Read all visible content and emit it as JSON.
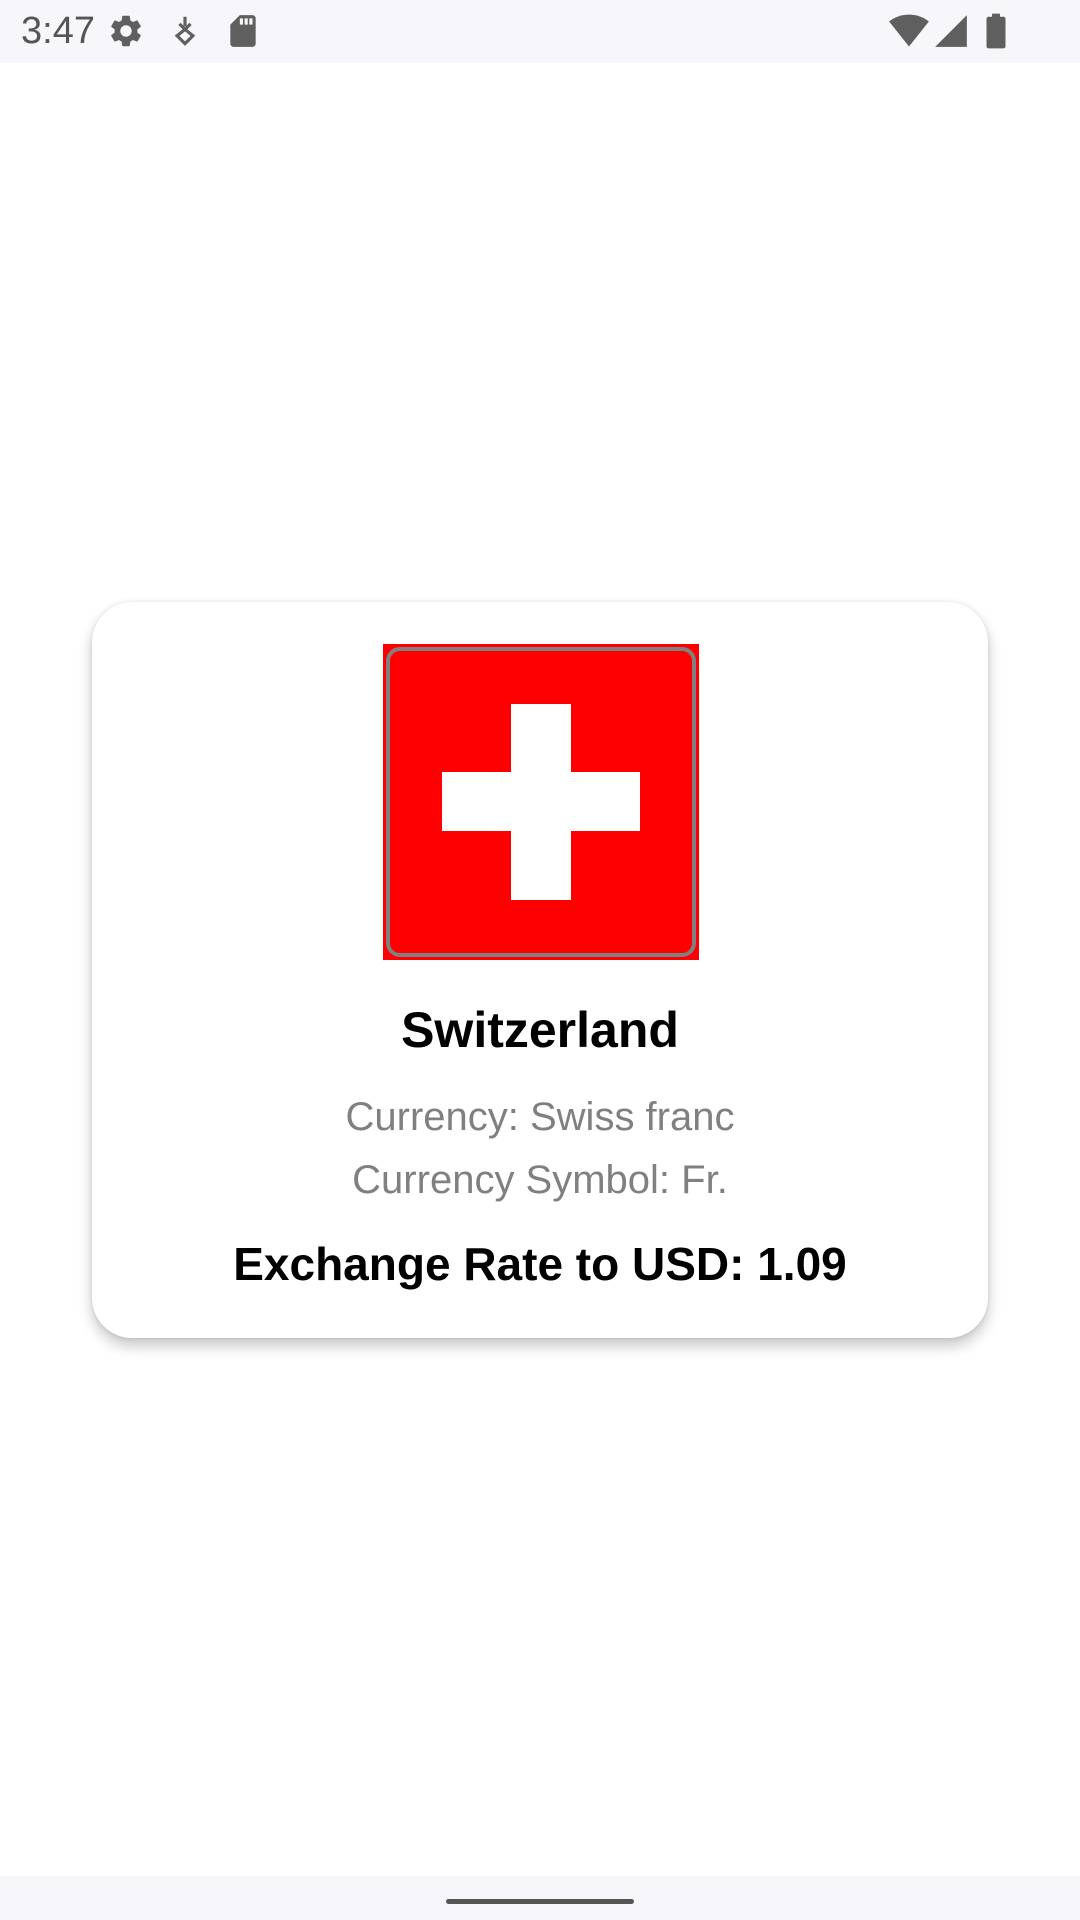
{
  "status_bar": {
    "time": "3:47",
    "left_icons": [
      "gear-icon",
      "download-icon",
      "sd-card-icon"
    ],
    "right_icons": [
      "wifi-icon",
      "cell-signal-icon",
      "battery-icon"
    ]
  },
  "country": {
    "name": "Switzerland",
    "flag_icon": "swiss-flag-icon",
    "currency_text": "Currency: Swiss franc",
    "symbol_text": "Currency Symbol: Fr.",
    "rate_text": "Exchange Rate to USD: 1.09"
  },
  "colors": {
    "flag_red": "#ff0000",
    "flag_cross": "#ffffff",
    "secondary_text": "#808080",
    "primary_text": "#000000"
  }
}
